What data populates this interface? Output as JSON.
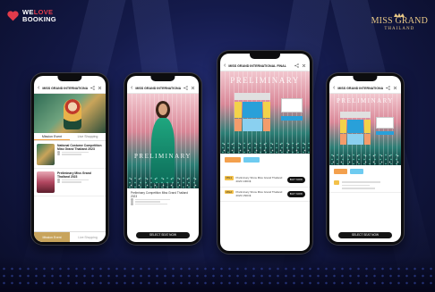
{
  "brand": {
    "line1_a": "WE",
    "line1_b": "LOVE",
    "line2": "BOOKING",
    "heart_color": "#e23b4b"
  },
  "partner": {
    "name": "MISS GRAND",
    "country": "THAILAND",
    "color": "#e8c887"
  },
  "event_title": "MISS GRAND INTERNATIONAL FINAL",
  "poster_text": "PRELIMINARY",
  "phone1": {
    "tabs": [
      "Mission Event",
      "Live Shopping"
    ],
    "events": [
      {
        "name": "National Costume Competition Miss Grand Thailand 2023"
      },
      {
        "name": "Preliminary Miss Grand Thailand 2023"
      }
    ],
    "footer_left": "Mission Event",
    "footer_right": "Live Shopping"
  },
  "phone2": {
    "caption": "Preliminary Competition Miss Grand Thailand 2023",
    "button": "SELECT SEAT NOW"
  },
  "phone3": {
    "tickets": [
      {
        "tag": "MG1",
        "text": "Preliminary Show Miss Grand Thailand 2023 1000 ฿"
      },
      {
        "tag": "MG2",
        "text": "Preliminary Show Miss Grand Thailand 2023 1500 ฿"
      }
    ],
    "buy_label": "BUY NOW"
  },
  "phone4": {
    "button": "SELECT SEAT NOW"
  },
  "colors": {
    "accent_gold": "#c8a45c",
    "zone_blue": "#29a0d9",
    "zone_light": "#8ad0f0",
    "zone_orange": "#f39c6b",
    "zone_yellow": "#f3d24a"
  }
}
